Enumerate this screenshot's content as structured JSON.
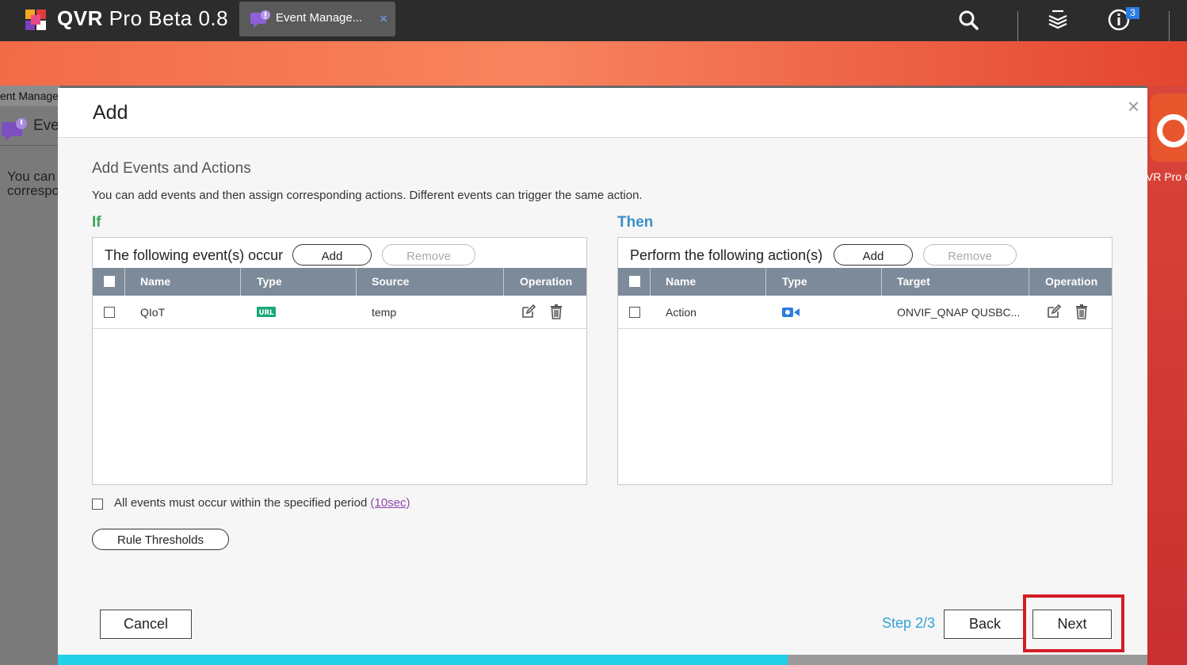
{
  "topbar": {
    "app_name_bold": "QVR",
    "app_name_rest": "Pro Beta 0.8",
    "tab_label": "Event Manage...",
    "tab_close": "×",
    "notification_count": "3"
  },
  "background": {
    "window_header": "ent Manager",
    "window_title": "Eve",
    "window_text_line1": "You can",
    "window_text_line2": "correspo",
    "right_app_label": "VR Pro C"
  },
  "modal": {
    "title": "Add",
    "close": "×",
    "section_title": "Add Events and Actions",
    "section_desc": "You can add events and then assign corresponding actions. Different events can trigger the same action.",
    "if_label": "If",
    "then_label": "Then",
    "events": {
      "caption": "The following event(s) occur",
      "add": "Add",
      "remove": "Remove",
      "columns": [
        "Name",
        "Type",
        "Source",
        "Operation"
      ],
      "rows": [
        {
          "name": "QIoT",
          "type_badge": "URL",
          "source": "temp"
        }
      ]
    },
    "actions": {
      "caption": "Perform the following action(s)",
      "add": "Add",
      "remove": "Remove",
      "columns": [
        "Name",
        "Type",
        "Target",
        "Operation"
      ],
      "rows": [
        {
          "name": "Action",
          "type_icon": "video-camera-icon",
          "target": "ONVIF_QNAP QUSBC..."
        }
      ]
    },
    "period_text": "All events must occur within the specified period",
    "period_link": "(10sec)",
    "rule_thresholds": "Rule Thresholds",
    "cancel": "Cancel",
    "step": "Step 2/3",
    "back": "Back",
    "next": "Next",
    "progress_fraction": 0.67
  },
  "colors": {
    "if_green": "#3aa65a",
    "then_blue": "#3a8fc8",
    "header_gray": "#7d8a99",
    "highlight_red": "#d31c24",
    "progress_cyan": "#1fd0e8"
  }
}
